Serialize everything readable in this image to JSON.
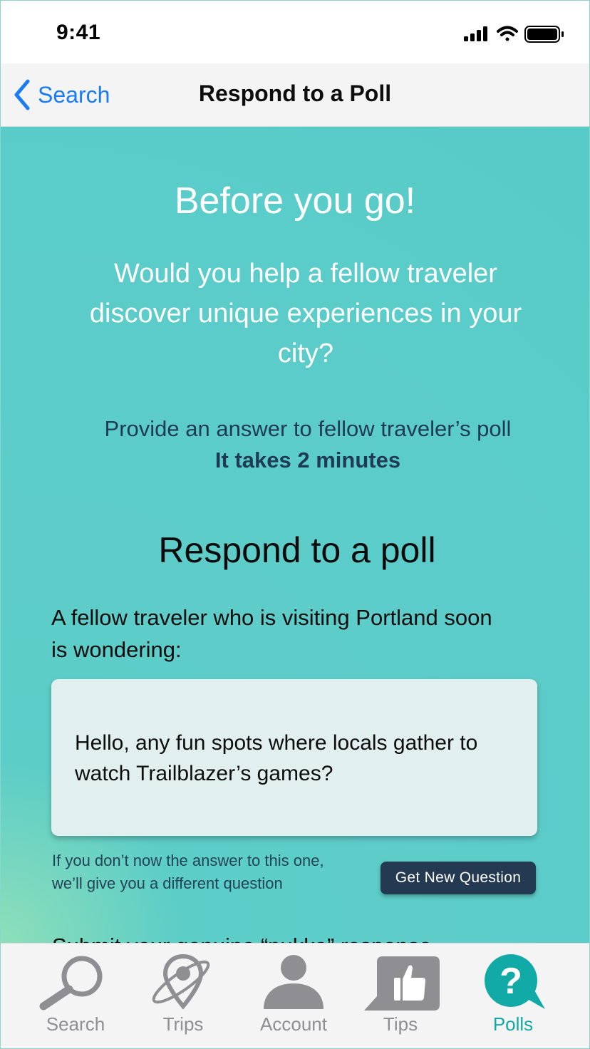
{
  "status_bar": {
    "time": "9:41"
  },
  "nav": {
    "back_label": "Search",
    "title": "Respond to a Poll"
  },
  "content": {
    "headline": "Before you go!",
    "subhead": "Would you help a fellow traveler discover unique experiences in your city?",
    "prompt": "Provide an answer to fellow traveler’s poll",
    "prompt_bold": "It takes 2 minutes",
    "section_title": "Respond to a poll",
    "intro": "A fellow traveler who is visiting Portland soon is wondering:",
    "question": "Hello, any fun spots where locals gather to watch Trailblazer’s games?",
    "skip_note_line1": "If you don’t now the answer to this one,",
    "skip_note_line2": "we’ll give you a different question",
    "new_question_button": "Get New Question",
    "submit_line": "Submit your genuine “pukka” response"
  },
  "tabs": [
    {
      "label": "Search",
      "icon": "search-icon",
      "active": false
    },
    {
      "label": "Trips",
      "icon": "planet-pin-icon",
      "active": false
    },
    {
      "label": "Account",
      "icon": "person-icon",
      "active": false
    },
    {
      "label": "Tips",
      "icon": "thumbs-up-icon",
      "active": false
    },
    {
      "label": "Polls",
      "icon": "question-bubble-icon",
      "active": true
    }
  ],
  "colors": {
    "accent": "#12aaa7",
    "background": "#5ccdc7",
    "button": "#243a52",
    "link": "#1a7cf5",
    "tab_inactive": "#8e8e93"
  }
}
